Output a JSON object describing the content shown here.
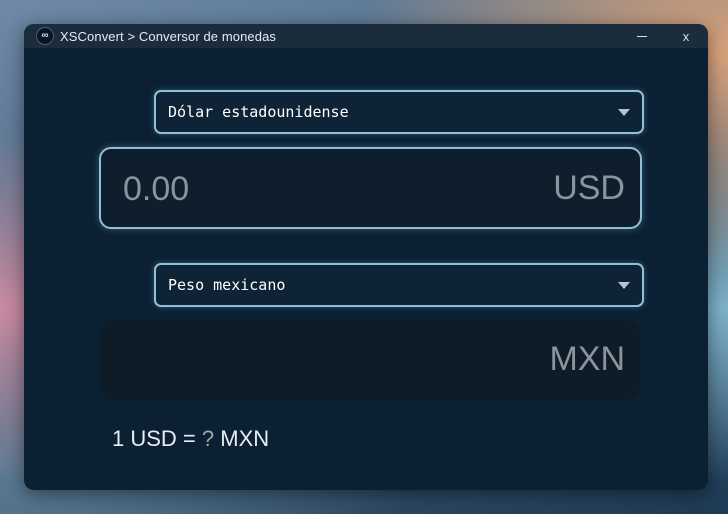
{
  "window": {
    "app_icon": "link-icon",
    "title": "XSConvert > Conversor de monedas",
    "close_label": "x"
  },
  "from": {
    "currency_name": "Dólar estadounidense",
    "amount_placeholder": "0.00",
    "currency_code": "USD"
  },
  "to": {
    "currency_name": "Peso mexicano",
    "amount_value": "",
    "currency_code": "MXN"
  },
  "rate": {
    "text_prefix": "1 USD = ",
    "value": "?",
    "text_suffix": " MXN"
  },
  "colors": {
    "window_bg": "#0b2033",
    "titlebar_bg": "#1b2c3d",
    "accent_border": "#8fc0d6",
    "muted_text": "#8a949d"
  }
}
